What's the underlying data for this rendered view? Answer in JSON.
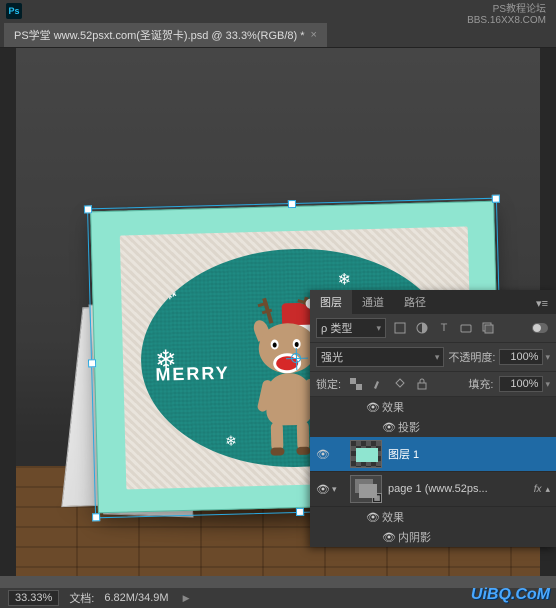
{
  "title_bar": {
    "app_abbrev": "Ps"
  },
  "document_tab": {
    "label": "PS学堂 www.52psxt.com(圣诞贺卡).psd @ 33.3%(RGB/8) *",
    "close": "×"
  },
  "watermark_top": {
    "line1": "PS教程论坛",
    "line2": "BBS.16XX8.COM"
  },
  "card": {
    "merry_text": "MERRY"
  },
  "status_bar": {
    "zoom": "33.33%",
    "doc_label": "文档:",
    "doc_value": "6.82M/34.9M"
  },
  "watermark_br": "UiBQ.CoM",
  "layers_panel": {
    "tabs": {
      "layers": "图层",
      "channels": "通道",
      "paths": "路径"
    },
    "kind_label": "ρ 类型",
    "blend_mode": "强光",
    "opacity_label": "不透明度:",
    "opacity_value": "100%",
    "lock_label": "锁定:",
    "fill_label": "填充:",
    "fill_value": "100%",
    "effects_label": "效果",
    "drop_shadow_label": "投影",
    "inner_shadow_label": "内阴影",
    "layer1_name": "图层 1",
    "page1_name": "page 1 (www.52ps...",
    "fx_badge": "fx"
  }
}
